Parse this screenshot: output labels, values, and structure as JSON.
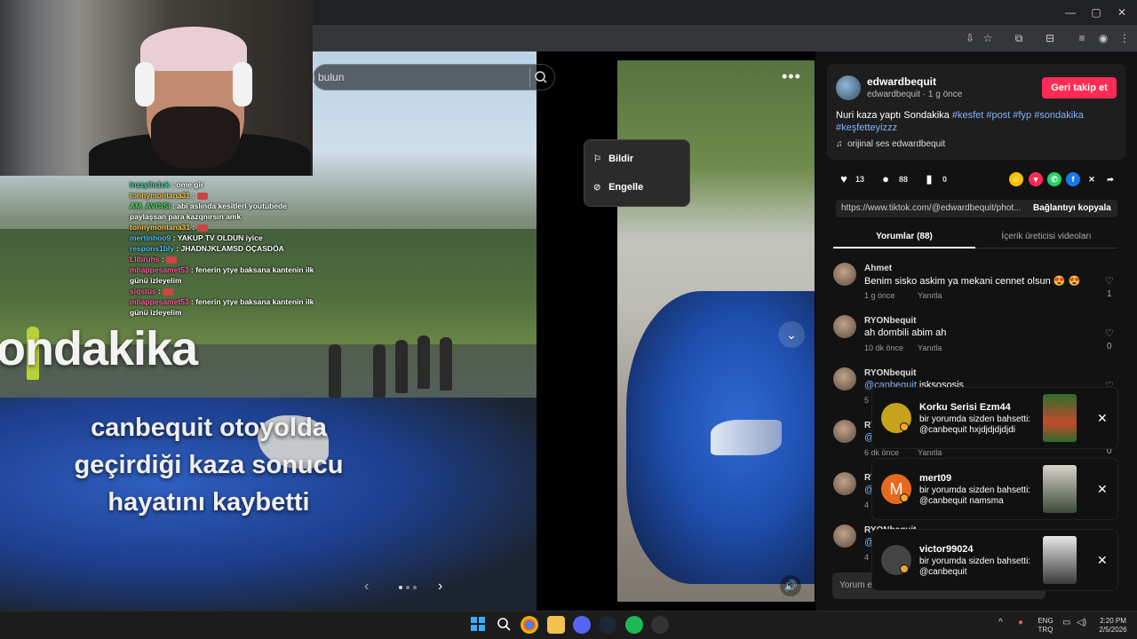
{
  "browser": {
    "window_controls": {
      "minimize": "—",
      "maximize": "▢",
      "close": "✕"
    }
  },
  "search": {
    "placeholder": "i bulun"
  },
  "media": {
    "overlay_title": "ondakika",
    "overlay_lines": [
      "canbequit otoyolda",
      "geçirdiği kaza sonucu",
      "hayatını kaybetti"
    ]
  },
  "chat": [
    {
      "user": "lnzzylln1ck",
      "sep": " : ",
      "msg": "ome gir",
      "color": "#38d6a8",
      "emote": false
    },
    {
      "user": "tonnymontana31",
      "sep": " : ",
      "msg": "",
      "color": "#f5c542",
      "emote": true
    },
    {
      "user": "AM_AVCISI",
      "sep": " : ",
      "msg": "abi aslında kesitleri youtubede paylaşsan para kazqnırsın amk",
      "color": "#4cd964",
      "emote": false
    },
    {
      "user": "tonnymontana31",
      "sep": " : ",
      "msg": "",
      "color": "#f5c542",
      "emote": true
    },
    {
      "user": "mertinhoo9",
      "sep": " : ",
      "msg": "YAKUP TV OLDUN iyice",
      "color": "#4fc3f7",
      "emote": false
    },
    {
      "user": "respons1bly",
      "sep": " : ",
      "msg": "JHADNJKLAMSD ÖÇASDÖA",
      "color": "#4fc3f7",
      "emote": false
    },
    {
      "user": "Lllbruhs",
      "sep": " : ",
      "msg": "",
      "color": "#ff5fa2",
      "emote": true
    },
    {
      "user": "mbappesamet53",
      "sep": " : ",
      "msg": "fenerin ytye baksana kantenin ilk günü izleyelim",
      "color": "#ff5fa2",
      "emote": false
    },
    {
      "user": "siqstus",
      "sep": " : ",
      "msg": "",
      "color": "#ff5fa2",
      "emote": true
    },
    {
      "user": "mbappesamet53",
      "sep": " : ",
      "msg": "fenerin ytye baksana kantenin ilk günü izleyelim",
      "color": "#ff5fa2",
      "emote": false
    }
  ],
  "menu": {
    "items": [
      {
        "icon": "flag-icon",
        "label": "Bildir"
      },
      {
        "icon": "block-icon",
        "label": "Engelle"
      }
    ]
  },
  "author": {
    "name": "edwardbequit",
    "meta": "edwardbequit · 1 g önce",
    "follow_label": "Geri takip et",
    "desc_text": "Nuri kaza yaptı Sondakika ",
    "tags": "#kesfet #post #fyp #sondakika #keşfetteyizzz",
    "music": "orijinal ses edwardbequit"
  },
  "stats": {
    "likes": "13",
    "comments": "88",
    "saves": "0"
  },
  "link": {
    "url": "https://www.tiktok.com/@edwardbequit/phot...",
    "copy_label": "Bağlantıyı kopyala"
  },
  "tabs": {
    "comments": "Yorumlar (88)",
    "creator": "İçerik üreticisi videoları"
  },
  "comments": [
    {
      "name": "Ahmet",
      "text": "Benim sisko askim ya mekani cennet olsun 😍 😍",
      "time": "1 g önce",
      "reply": "Yanıtla",
      "likes": "1"
    },
    {
      "name": "RYONbequit",
      "text": "ah dombili abim ah",
      "time": "10 dk önce",
      "reply": "Yanıtla",
      "likes": "0"
    },
    {
      "name": "RYONbequit",
      "mention": "@canbequit",
      "text": " isksososis",
      "time": "5",
      "reply": "",
      "likes": ""
    },
    {
      "name": "RY",
      "mention": "@",
      "text": "",
      "time": "6 dk önce",
      "reply": "Yanıtla",
      "likes": "0"
    },
    {
      "name": "RY",
      "mention": "@",
      "text": "",
      "time": "4",
      "reply": "",
      "likes": ""
    },
    {
      "name": "RYONbequit",
      "mention": "@",
      "text": "",
      "time": "4",
      "reply": "",
      "likes": ""
    }
  ],
  "comment_input": {
    "placeholder": "Yorum ek"
  },
  "notifications": [
    {
      "name": "Korku Serisi Ezm44",
      "line1": "bir yorumda sizden bahsetti:",
      "line2": "@canbequit hxjdjdjdjdjdi",
      "avatar_color": "#c7a21b"
    },
    {
      "name": "mert09",
      "line1": "bir yorumda sizden bahsetti:",
      "line2": "@canbequit namsma",
      "avatar_color": "#e56a1e",
      "avatar_letter": "M"
    },
    {
      "name": "victor99024",
      "line1": "bir yorumda sizden bahsetti:",
      "line2": "@canbequit",
      "avatar_color": "#444"
    }
  ],
  "taskbar": {
    "lang_top": "ENG",
    "lang_bottom": "TRQ",
    "time": "2:20 PM",
    "date": "2/5/2026"
  }
}
